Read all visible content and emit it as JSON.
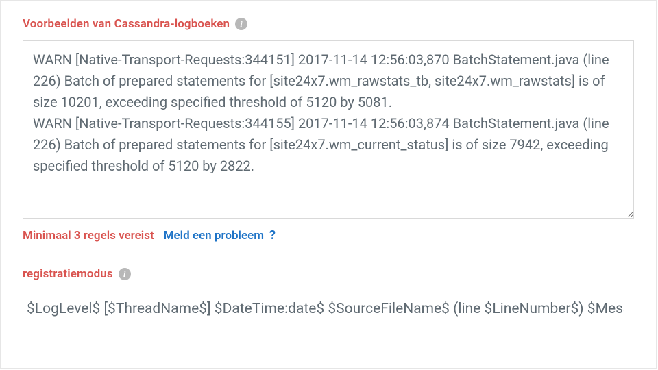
{
  "labels": {
    "logSamples": "Voorbeelden van Cassandra-logboeken",
    "registrationMode": "registratiemodus"
  },
  "logText": "WARN [Native-Transport-Requests:344151] 2017-11-14 12:56:03,870 BatchStatement.java (line 226) Batch of prepared statements for [site24x7.wm_rawstats_tb, site24x7.wm_rawstats] is of size 10201, exceeding specified threshold of 5120 by 5081.\nWARN [Native-Transport-Requests:344155] 2017-11-14 12:56:03,874 BatchStatement.java (line 226) Batch of prepared statements for [site24x7.wm_current_status] is of size 7942, exceeding specified threshold of 5120 by 2822.",
  "helper": {
    "minLines": "Minimaal 3 regels vereist",
    "report": "Meld een probleem",
    "q": "?"
  },
  "patternValue": "$LogLevel$ [$ThreadName$] $DateTime:date$ $SourceFileName$ (line $LineNumber$) $Message$",
  "icons": {
    "info": "i"
  }
}
